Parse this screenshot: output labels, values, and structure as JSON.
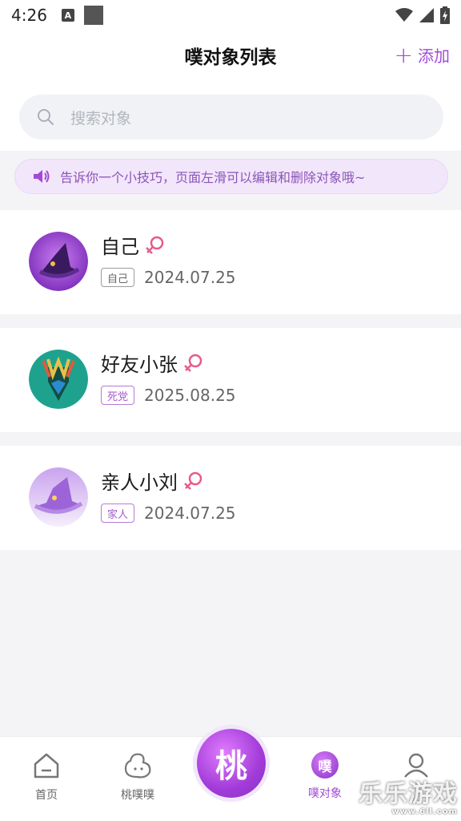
{
  "status": {
    "time": "4:26",
    "a_badge": "A"
  },
  "header": {
    "title": "噗对象列表",
    "add_label": "添加"
  },
  "search": {
    "placeholder": "搜索对象"
  },
  "tip": {
    "text": "告诉你一个小技巧，页面左滑可以编辑和删除对象哦~"
  },
  "contacts": [
    {
      "name": "自己",
      "tag": "自己",
      "date": "2024.07.25",
      "avatar_icon": "witch-hat-purple-icon",
      "gender_icon": "female-symbol-icon"
    },
    {
      "name": "好友小张",
      "tag": "死党",
      "date": "2025.08.25",
      "avatar_icon": "magisk-mask-icon",
      "gender_icon": "female-symbol-icon"
    },
    {
      "name": "亲人小刘",
      "tag": "家人",
      "date": "2024.07.25",
      "avatar_icon": "witch-hat-lilac-icon",
      "gender_icon": "female-symbol-icon"
    }
  ],
  "tabs": [
    {
      "label": "首页",
      "icon": "home-icon"
    },
    {
      "label": "桃噗噗",
      "icon": "mascot-icon"
    },
    {
      "label": "桃",
      "icon": "peach-center-icon"
    },
    {
      "label": "噗对象",
      "icon": "pu-object-icon"
    },
    {
      "label": "",
      "icon": "profile-icon"
    }
  ],
  "center_badge": "噗",
  "watermark": {
    "text": "乐乐游戏",
    "sub": "www.6ll.com"
  },
  "colors": {
    "accent": "#a24ad6",
    "tip_bg": "#f2e6fb",
    "female": "#e85a8a"
  }
}
